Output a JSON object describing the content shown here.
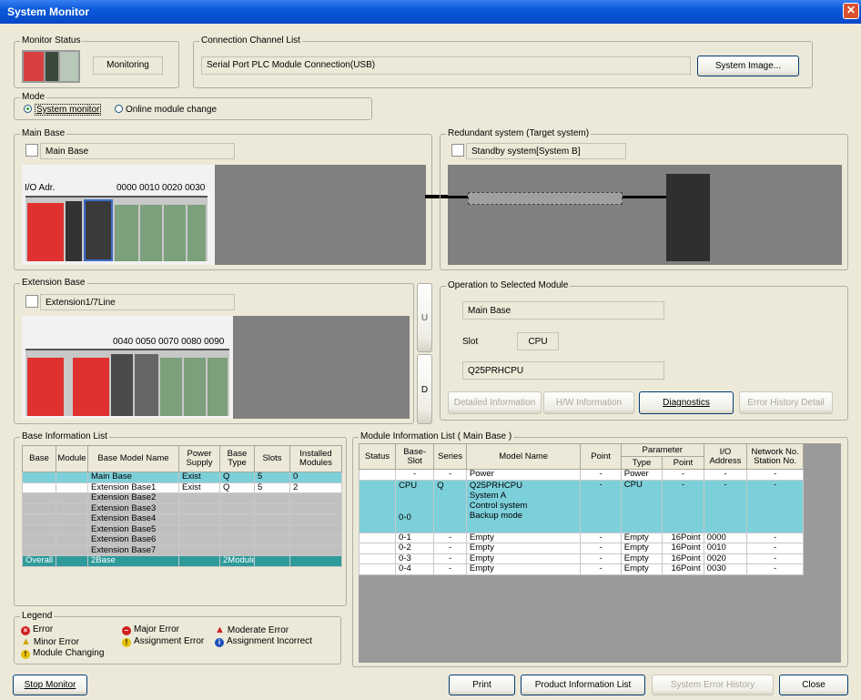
{
  "window": {
    "title": "System Monitor",
    "close_glyph": "✕"
  },
  "monitor_status": {
    "legend": "Monitor Status",
    "status": "Monitoring"
  },
  "connection": {
    "legend": "Connection Channel List",
    "value": "Serial Port  PLC Module Connection(USB)",
    "system_image_label": "System Image..."
  },
  "mode": {
    "legend": "Mode",
    "opt1": "System monitor",
    "opt2": "Online module change",
    "selected": "System monitor"
  },
  "main_base": {
    "legend": "Main Base",
    "name": "Main Base",
    "io_label": "I/O Adr.",
    "io_addr": "0000 0010 0020 0030"
  },
  "redundant": {
    "legend": "Redundant system (Target system)",
    "name": "Standby system[System B]"
  },
  "ext_base": {
    "legend": "Extension Base",
    "name": "Extension1/7Line",
    "io_addr": "0040 0050 0070 0080 0090",
    "up": "U",
    "down": "D"
  },
  "operation": {
    "legend": "Operation to Selected Module",
    "base": "Main Base",
    "slot_label": "Slot",
    "slot_value": "CPU",
    "model": "Q25PRHCPU",
    "buttons": {
      "detailed": "Detailed Information",
      "hw": "H/W Information",
      "diag": "Diagnostics",
      "err_hist": "Error History Detail"
    }
  },
  "base_info": {
    "legend": "Base Information List",
    "headers": [
      "Base",
      "Module",
      "Base Model Name",
      "Power Supply",
      "Base Type",
      "Slots",
      "Installed Modules"
    ],
    "rows": [
      [
        "",
        "",
        "Main Base",
        "Exist",
        "Q",
        "5",
        "0"
      ],
      [
        "",
        "",
        "Extension Base1",
        "Exist",
        "Q",
        "5",
        "2"
      ],
      [
        "",
        "",
        "Extension Base2",
        "",
        "",
        "",
        ""
      ],
      [
        "",
        "",
        "Extension Base3",
        "",
        "",
        "",
        ""
      ],
      [
        "",
        "",
        "Extension Base4",
        "",
        "",
        "",
        ""
      ],
      [
        "",
        "",
        "Extension Base5",
        "",
        "",
        "",
        ""
      ],
      [
        "",
        "",
        "Extension Base6",
        "",
        "",
        "",
        ""
      ],
      [
        "",
        "",
        "Extension Base7",
        "",
        "",
        "",
        ""
      ],
      [
        "Overall",
        "",
        "2Base",
        "",
        "2Module",
        "",
        ""
      ]
    ]
  },
  "legend_box": {
    "legend": "Legend",
    "error": "Error",
    "major": "Major Error",
    "moderate": "Moderate Error",
    "minor": "Minor Error",
    "assign_err": "Assignment Error",
    "assign_inc": "Assignment Incorrect",
    "changing": "Module Changing"
  },
  "module_info": {
    "legend": "Module Information List ( Main Base )",
    "h_status": "Status",
    "h_baseslot": "Base-\nSlot",
    "h_series": "Series",
    "h_model": "Model Name",
    "h_point": "Point",
    "h_param": "Parameter",
    "h_type": "Type",
    "h_ppoint": "Point",
    "h_io": "I/O\nAddress",
    "h_net": "Network No.\nStation No.",
    "rows": [
      {
        "slot": "-",
        "series": "-",
        "model": "Power",
        "point": "-",
        "type": "Power",
        "ppoint": "-",
        "io": "-",
        "net": "-"
      },
      {
        "slot": "0-1",
        "series": "-",
        "model": "Empty",
        "point": "-",
        "type": "Empty",
        "ppoint": "16Point",
        "io": "0000",
        "net": "-"
      },
      {
        "slot": "0-2",
        "series": "-",
        "model": "Empty",
        "point": "-",
        "type": "Empty",
        "ppoint": "16Point",
        "io": "0010",
        "net": "-"
      },
      {
        "slot": "0-3",
        "series": "-",
        "model": "Empty",
        "point": "-",
        "type": "Empty",
        "ppoint": "16Point",
        "io": "0020",
        "net": "-"
      },
      {
        "slot": "0-4",
        "series": "-",
        "model": "Empty",
        "point": "-",
        "type": "Empty",
        "ppoint": "16Point",
        "io": "0030",
        "net": "-"
      }
    ],
    "cpu_row": {
      "slot1": "CPU",
      "slot2": "0-0",
      "series": "Q",
      "model1": "Q25PRHCPU",
      "model2": "System A",
      "model3": "Control system",
      "model4": "Backup mode",
      "point": "-",
      "type": "CPU",
      "ppoint": "-",
      "io": "-",
      "net": "-"
    }
  },
  "footer": {
    "stop": "Stop Monitor",
    "print": "Print",
    "pil": "Product Information List",
    "seh": "System Error History",
    "close": "Close"
  }
}
